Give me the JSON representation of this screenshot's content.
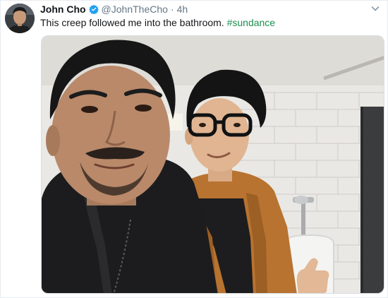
{
  "tweet": {
    "author_name": "John Cho",
    "handle": "@JohnTheCho",
    "separator": "·",
    "time": "4h",
    "text": "This creep followed me into the bathroom.",
    "hashtag": "#sundance"
  },
  "icons": {
    "verified": "verified-badge-icon",
    "caret": "chevron-down-icon"
  },
  "colors": {
    "verified": "#1da1f2",
    "hashtag": "#1b8f4f",
    "secondary_text": "#657786"
  }
}
